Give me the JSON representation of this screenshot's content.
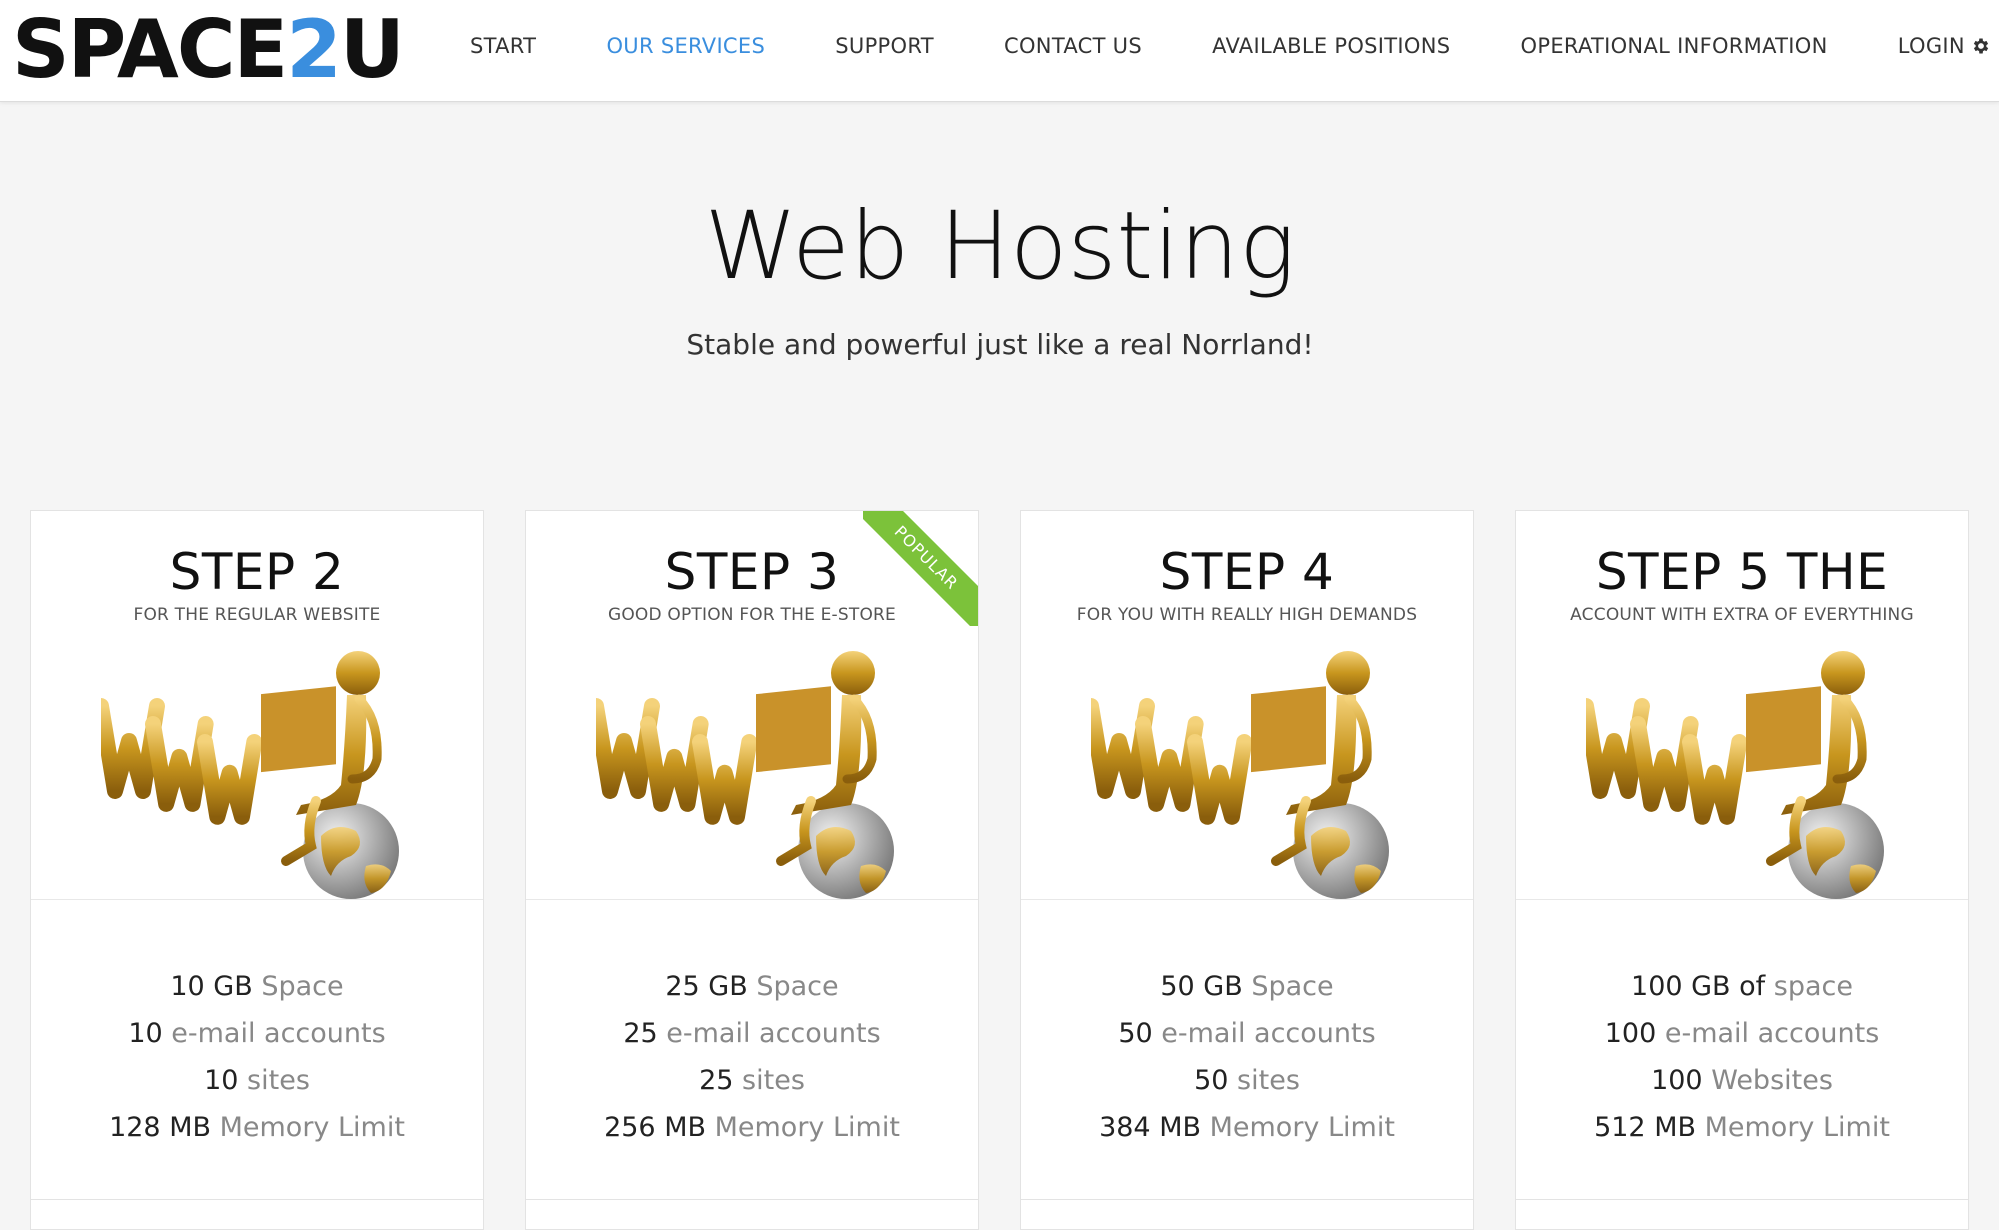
{
  "brand": {
    "logo_dark": "SPACE",
    "logo_blue": "2",
    "logo_tail": "U",
    "accent_color": "#3a8ede"
  },
  "nav": {
    "items": [
      {
        "label": "START",
        "active": false
      },
      {
        "label": "OUR SERVICES",
        "active": true
      },
      {
        "label": "SUPPORT",
        "active": false
      },
      {
        "label": "CONTACT US",
        "active": false
      },
      {
        "label": "AVAILABLE POSITIONS",
        "active": false
      },
      {
        "label": "OPERATIONAL INFORMATION",
        "active": false
      },
      {
        "label": "LOGIN",
        "active": false,
        "icon": "gear-icon"
      }
    ]
  },
  "hero": {
    "title": "Web Hosting",
    "subtitle": "Stable and powerful just like a real Norrland!"
  },
  "plans": [
    {
      "title": "STEP 2",
      "subtitle": "FOR THE REGULAR WEBSITE",
      "badge": "",
      "features": [
        {
          "value": "10 GB",
          "label": " Space"
        },
        {
          "value": "10",
          "label": " e-mail accounts"
        },
        {
          "value": "10",
          "label": " sites"
        },
        {
          "value": "128 MB",
          "label": " Memory Limit"
        }
      ]
    },
    {
      "title": "STEP 3",
      "subtitle": "GOOD OPTION FOR THE E-STORE",
      "badge": "POPULAR",
      "badge_color": "#7cc23a",
      "features": [
        {
          "value": "25 GB",
          "label": " Space"
        },
        {
          "value": "25",
          "label": " e-mail accounts"
        },
        {
          "value": "25",
          "label": " sites"
        },
        {
          "value": "256 MB",
          "label": " Memory Limit"
        }
      ]
    },
    {
      "title": "STEP 4",
      "subtitle": "FOR YOU WITH REALLY HIGH DEMANDS",
      "badge": "",
      "features": [
        {
          "value": "50 GB",
          "label": " Space"
        },
        {
          "value": "50",
          "label": " e-mail accounts"
        },
        {
          "value": "50",
          "label": " sites"
        },
        {
          "value": "384 MB",
          "label": " Memory Limit"
        }
      ]
    },
    {
      "title": "STEP 5 THE",
      "subtitle": "ACCOUNT WITH EXTRA OF EVERYTHING",
      "badge": "",
      "features": [
        {
          "value": "100 GB of",
          "label": " space"
        },
        {
          "value": "100",
          "label": " e-mail accounts"
        },
        {
          "value": "100",
          "label": " Websites"
        },
        {
          "value": "512 MB",
          "label": " Memory Limit"
        }
      ]
    }
  ]
}
